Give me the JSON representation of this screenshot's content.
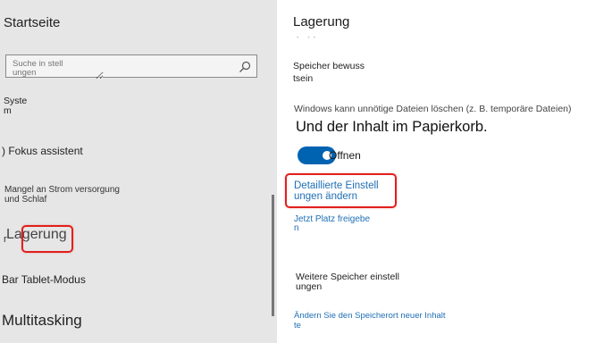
{
  "sidebar": {
    "home_title": "Startseite",
    "search": {
      "value": "",
      "placeholder": "Suche in stell\nungen"
    },
    "items": [
      {
        "label": "Syste\nm"
      },
      {
        "label": ") Fokus assistent"
      },
      {
        "label": "Mangel an Strom versorgung\n und Schlaf"
      },
      {
        "icon_text": "r",
        "label": "Lagerung",
        "selected": true
      },
      {
        "label": "Bar Tablet-Modus"
      },
      {
        "label": "Multitasking"
      }
    ]
  },
  "main": {
    "title": "Lagerung",
    "title_fragment": "- --",
    "storage_sense_label": "Speicher bewuss\ntsein",
    "description": "Windows kann unnötige Dateien löschen (z. B. temporäre Dateien)",
    "recycle_text": "Und der Inhalt im Papierkorb.",
    "toggle": {
      "label": "Offnen",
      "on": true
    },
    "advanced_link": "Detaillierte Einstell\nungen ändern",
    "free_space_link": "Jetzt Platz freigebe\nn",
    "more_storage_label": "Weitere Speicher einstell\nungen",
    "change_location_link": "Ändern Sie den Speicherort neuer Inhalt\nte"
  },
  "colors": {
    "accent": "#0063b1",
    "link": "#1f6fb5",
    "annotation": "#e0201e",
    "sidebar_bg": "#e6e6e6"
  }
}
